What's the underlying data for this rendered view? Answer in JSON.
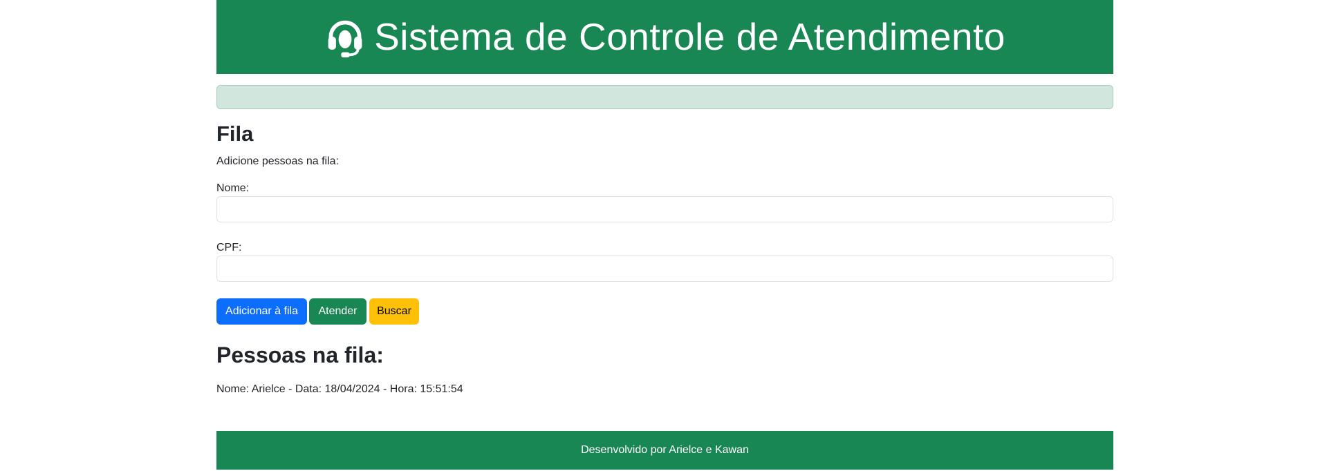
{
  "header": {
    "title": "Sistema de Controle de Atendimento",
    "icon": "headset-icon",
    "background_color": "#198754"
  },
  "alert": {
    "text": "",
    "background_color": "#d1e7dd"
  },
  "form": {
    "title": "Fila",
    "subtitle": "Adicione pessoas na fila:",
    "nome_label": "Nome:",
    "nome_value": "",
    "cpf_label": "CPF:",
    "cpf_value": ""
  },
  "buttons": {
    "add_label": "Adicionar à fila",
    "atender_label": "Atender",
    "buscar_label": "Buscar"
  },
  "queue": {
    "title": "Pessoas na fila:",
    "items": [
      "Nome: Arielce - Data: 18/04/2024 - Hora: 15:51:54"
    ]
  },
  "footer": {
    "text": "Desenvolvido por Arielce e Kawan"
  },
  "colors": {
    "primary": "#0d6efd",
    "success": "#198754",
    "warning": "#ffc107"
  }
}
